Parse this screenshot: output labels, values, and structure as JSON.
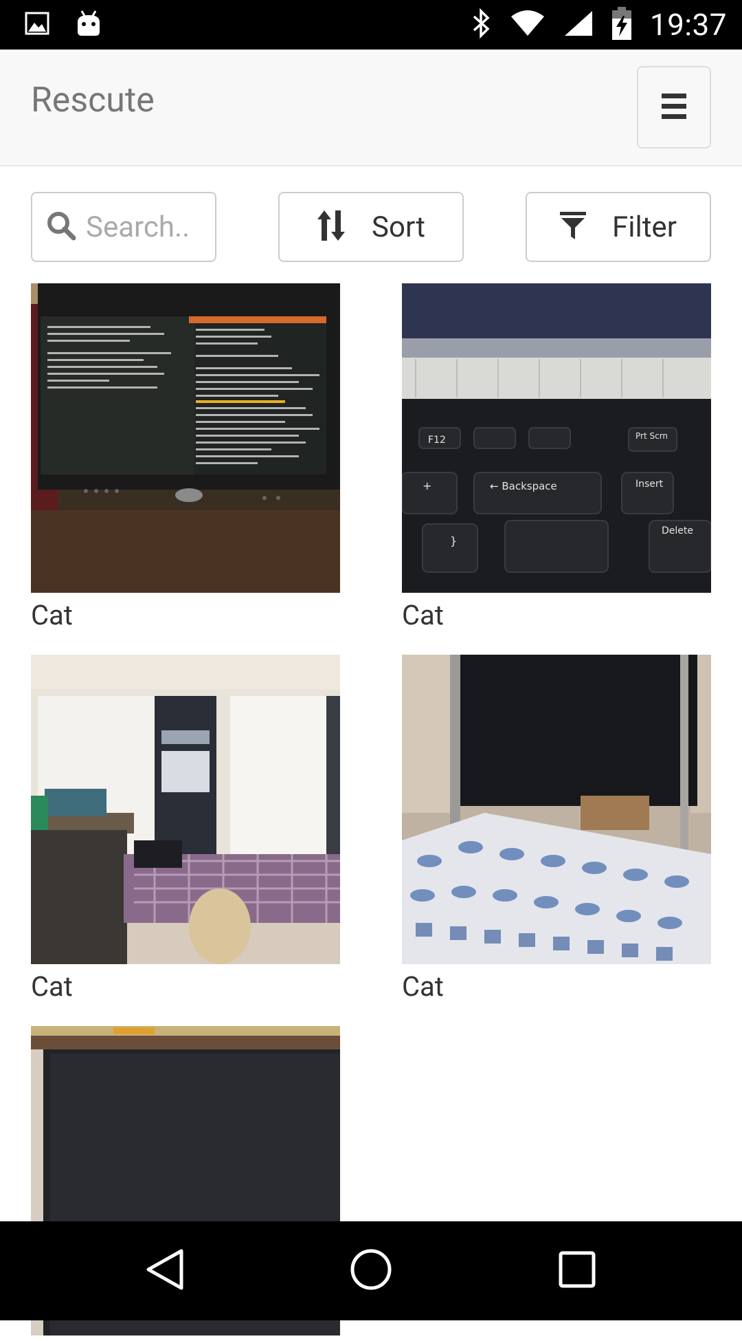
{
  "status_bar": {
    "time": "19:37",
    "left_icons": [
      "image-notification-icon",
      "android-notification-icon"
    ],
    "right_icons": [
      "bluetooth-icon",
      "wifi-icon",
      "cell-signal-icon",
      "battery-charging-icon"
    ]
  },
  "app_bar": {
    "title": "Rescute",
    "menu_icon": "hamburger-menu-icon"
  },
  "toolbar": {
    "search": {
      "placeholder": "Search..",
      "value": "",
      "icon": "search-icon"
    },
    "sort": {
      "label": "Sort",
      "icon": "sort-icon"
    },
    "filter": {
      "label": "Filter",
      "icon": "filter-icon"
    }
  },
  "grid": {
    "items": [
      {
        "caption": "Cat",
        "photo": "computer-monitor-photo"
      },
      {
        "caption": "Cat",
        "photo": "keyboard-photo"
      },
      {
        "caption": "Cat",
        "photo": "bedroom-closet-photo"
      },
      {
        "caption": "Cat",
        "photo": "desk-bed-photo"
      },
      {
        "caption": "",
        "photo": "monitor-back-photo"
      }
    ]
  },
  "nav_bar": {
    "buttons": [
      "back-icon",
      "home-icon",
      "recents-icon"
    ]
  },
  "colors": {
    "status_bar": "#000000",
    "app_bar_bg": "#f8f8f8",
    "title_text": "#777777",
    "border": "#cccccc",
    "caption_text": "#333333"
  }
}
